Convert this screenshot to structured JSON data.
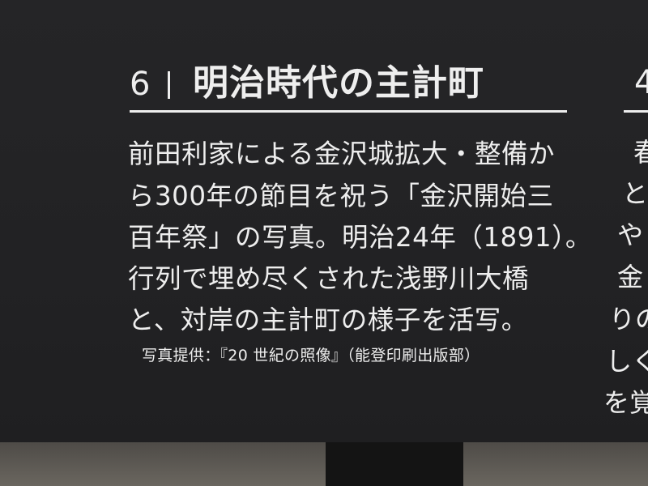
{
  "panel": {
    "number": "6",
    "title": "明治時代の主計町",
    "body_lines": [
      "前田利家による金沢城拡大・整備か",
      "ら300年の節目を祝う「金沢開始三",
      "百年祭」の写真。明治24年（1891）。",
      "行列で埋め尽くされた浅野川大橋",
      "と、対岸の主計町の様子を活写。"
    ],
    "credit": "写真提供：『20 世紀の照像』（能登印刷出版部）"
  },
  "adjacent_panel": {
    "number": "4",
    "fragments": [
      "春",
      "と",
      "や",
      "金",
      "りの",
      "しく",
      "を覚"
    ]
  },
  "colors": {
    "panel_background": "#232325",
    "text": "#eeeeee",
    "floor": "#5c5852"
  }
}
